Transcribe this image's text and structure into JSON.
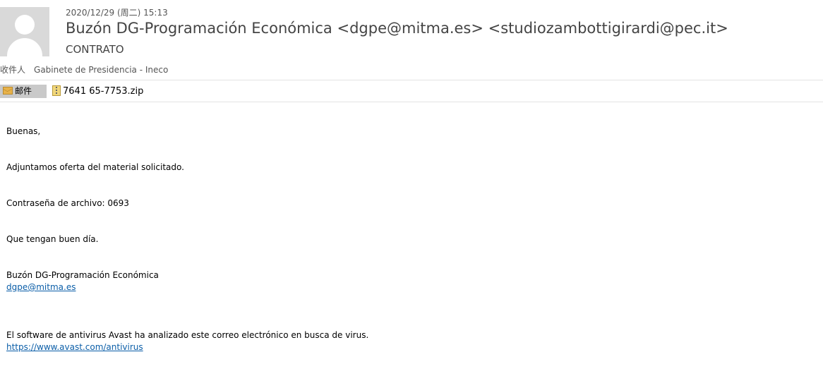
{
  "header": {
    "date": "2020/12/29 (周二) 15:13",
    "sender": "Buzón DG-Programación Económica <dgpe@mitma.es> <studiozambottigirardi@pec.it>",
    "subject": "CONTRATO",
    "recipients_label": "收件人",
    "recipients": "Gabinete de Presidencia - Ineco"
  },
  "attachments_bar": {
    "mail_tab_label": "邮件",
    "attachment_name": "7641 65-7753.zip"
  },
  "body": {
    "greeting": "Buenas,",
    "line1": "Adjuntamos oferta del material solicitado.",
    "password_line": "Contraseña de archivo: 0693",
    "closing": "Que tengan buen día.",
    "signature_name": "Buzón DG-Programación Económica",
    "signature_email": "dgpe@mitma.es",
    "antivirus_note": "El software de antivirus Avast ha analizado este correo electrónico en busca de virus.",
    "antivirus_link": "https://www.avast.com/antivirus"
  }
}
